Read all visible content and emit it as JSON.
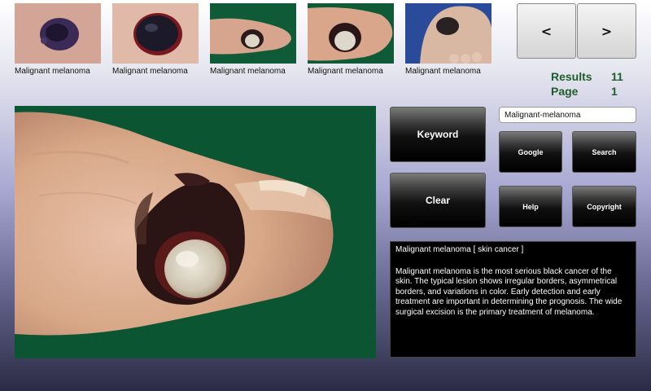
{
  "thumbnails": [
    {
      "caption": "Malignant melanoma"
    },
    {
      "caption": "Malignant melanoma"
    },
    {
      "caption": "Malignant melanoma"
    },
    {
      "caption": "Malignant melanoma"
    },
    {
      "caption": "Malignant melanoma"
    }
  ],
  "nav": {
    "prev": "<",
    "next": ">"
  },
  "stats": {
    "results_label": "Results",
    "results_value": "11",
    "page_label": "Page",
    "page_value": "1"
  },
  "buttons": {
    "keyword": "Keyword",
    "clear": "Clear",
    "google": "Google",
    "search": "Search",
    "help": "Help",
    "copyright": "Copyright"
  },
  "search": {
    "value": "Malignant-melanoma"
  },
  "description": {
    "title": "Malignant melanoma  [ skin cancer ]",
    "body": "Malignant melanoma is the most serious black cancer of the skin. The typical lesion shows irregular borders, asymmetrical borders, and variations in color. Early detection and early treatment are important in determining the prognosis. The wide surgical excision is the primary treatment of melanoma."
  },
  "colors": {
    "stat_text": "#1d5e2a",
    "panel_bg": "#000000",
    "background_green": "#0f5b38"
  }
}
